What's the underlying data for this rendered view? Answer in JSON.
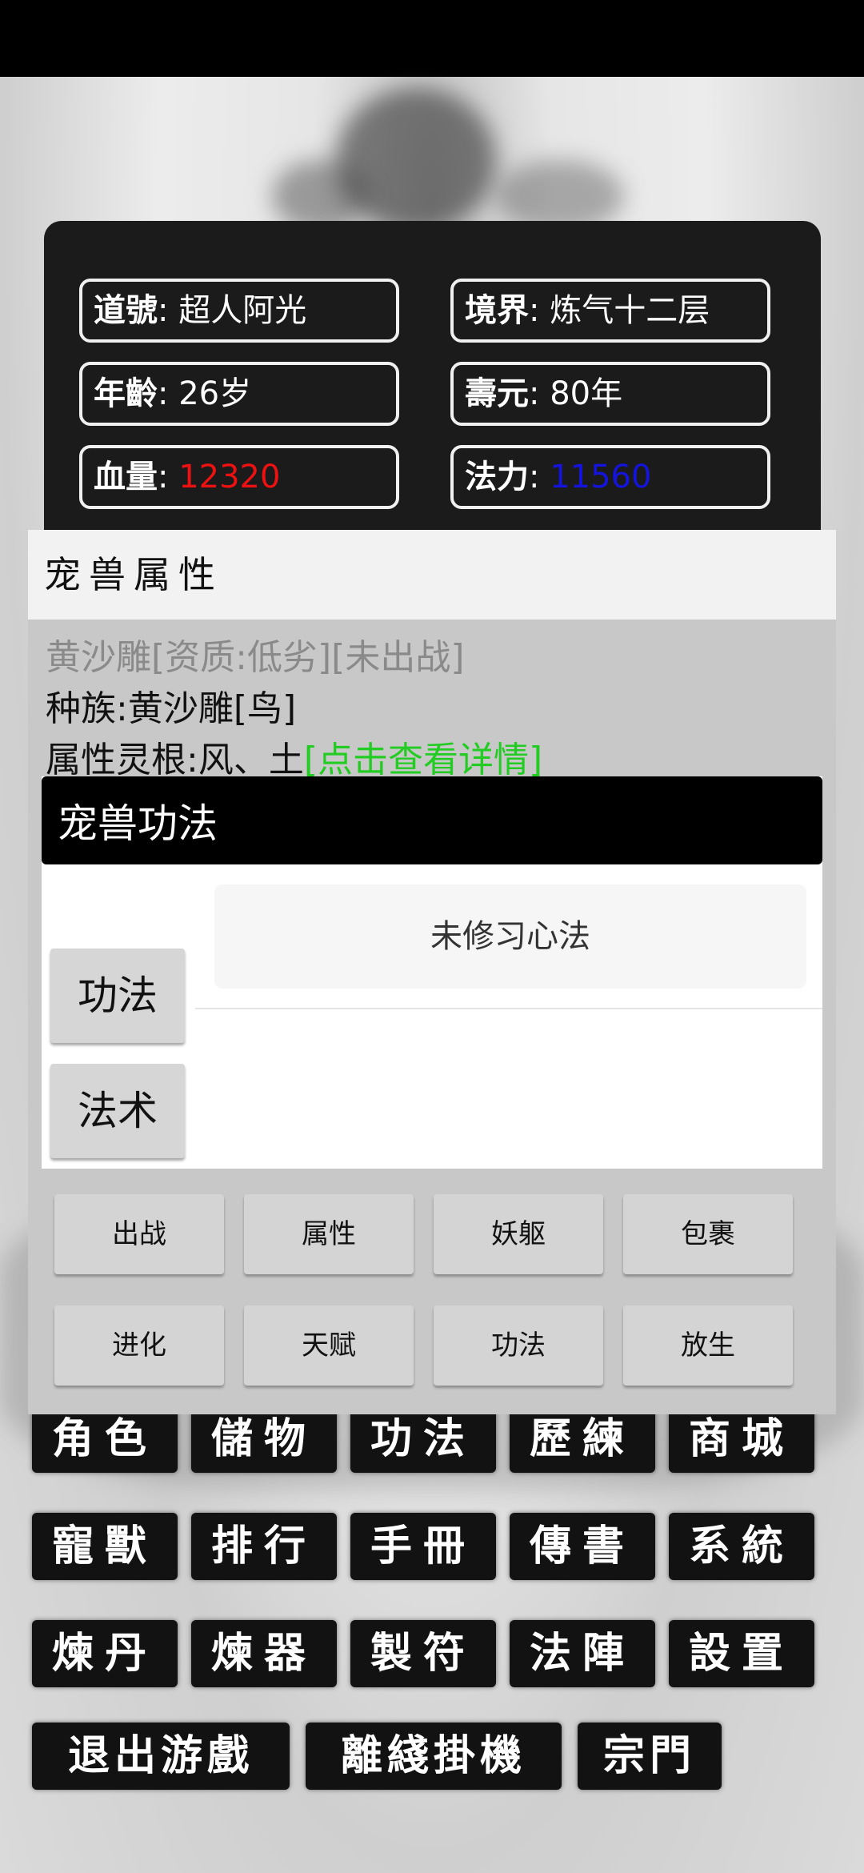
{
  "status": {
    "daohao_key": "道號",
    "daohao_val": "超人阿光",
    "jingjie_key": "境界",
    "jingjie_val": "炼气十二层",
    "age_key": "年齡",
    "age_val": "26岁",
    "shouyuan_key": "壽元",
    "shouyuan_val": "80年",
    "hp_key": "血量",
    "hp_val": "12320",
    "mp_key": "法力",
    "mp_val": "11560"
  },
  "colors": {
    "hp": "#ee1111",
    "mp": "#1414dd",
    "link": "#22cc22"
  },
  "pet_panel": {
    "title": "宠兽属性",
    "line1": "黄沙雕[资质:低劣][未出战]",
    "line2": "种族:黄沙雕[鸟]",
    "line3": "属性灵根:风、土",
    "line3_link": "[点击查看详情]"
  },
  "skill_dialog": {
    "title": "宠兽功法",
    "tab_gongfa": "功法",
    "tab_fashu": "法术",
    "empty_text": "未修习心法"
  },
  "pet_buttons": [
    "出战",
    "属性",
    "妖躯",
    "包裹",
    "进化",
    "天赋",
    "功法",
    "放生"
  ],
  "main_menu": [
    "角色",
    "儲物",
    "功法",
    "歷練",
    "商城",
    "寵獸",
    "排行",
    "手冊",
    "傳書",
    "系統",
    "煉丹",
    "煉器",
    "製符",
    "法陣",
    "設置",
    "退出游戲",
    "離綫掛機",
    "宗門"
  ],
  "icons": {
    "background": "ink-wash-figure-icon"
  }
}
